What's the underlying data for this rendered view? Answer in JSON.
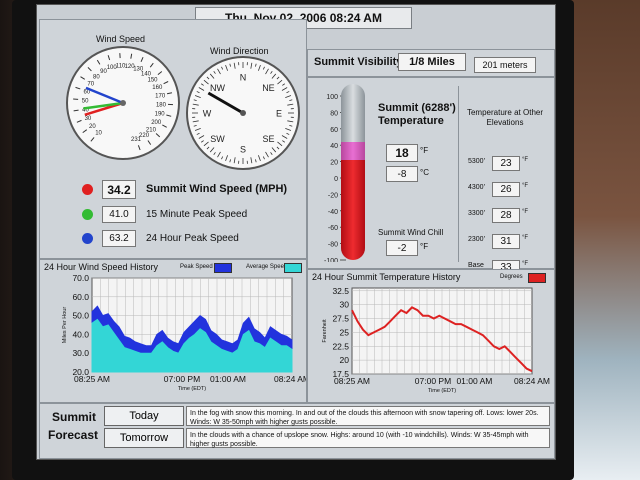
{
  "header": {
    "date_time": "Thu, Nov 02, 2006  08:24 AM"
  },
  "wind": {
    "speed_title": "Wind Speed",
    "direction_title": "Wind Direction",
    "speed_ticks": [
      "10",
      "20",
      "30",
      "40",
      "50",
      "60",
      "70",
      "80",
      "90",
      "100",
      "110",
      "120",
      "130",
      "140",
      "150",
      "160",
      "170",
      "180",
      "190",
      "200",
      "210",
      "220",
      "231"
    ],
    "compass": [
      "N",
      "NE",
      "E",
      "SE",
      "S",
      "SW",
      "W",
      "NW"
    ],
    "direction_deg": 300,
    "summit_speed_value": "34.2",
    "summit_speed_label": "Summit Wind Speed (MPH)",
    "peak15_value": "41.0",
    "peak15_label": "15 Minute Peak Speed",
    "peak24_value": "63.2",
    "peak24_label": "24 Hour Peak Speed",
    "colors": {
      "summit": "#e02020",
      "peak15": "#33bb33",
      "peak24": "#2244cc"
    }
  },
  "visibility": {
    "label": "Summit Visibility",
    "miles": "1/8 Miles",
    "meters": "201 meters"
  },
  "temperature": {
    "title": "Summit (6288') Temperature",
    "value_f": "18",
    "unit_f": "°F",
    "value_c": "-8",
    "unit_c": "°C",
    "scale": [
      "100",
      "80",
      "60",
      "40",
      "20",
      "0",
      "-20",
      "-40",
      "-60",
      "-80",
      "-100"
    ],
    "wind_chill_label": "Summit Wind Chill",
    "wind_chill_value": "-2",
    "wind_chill_unit": "°F"
  },
  "elevations": {
    "title": "Temperature at Other Elevations",
    "rows": [
      {
        "elev": "5300'",
        "temp": "23"
      },
      {
        "elev": "4300'",
        "temp": "26"
      },
      {
        "elev": "3300'",
        "temp": "28"
      },
      {
        "elev": "2300'",
        "temp": "31"
      },
      {
        "elev": "Base",
        "temp": "33"
      }
    ],
    "unit": "°F"
  },
  "wind_history": {
    "title": "24 Hour Wind Speed History",
    "legend_peak": "Peak Speed",
    "legend_avg": "Average Speed",
    "ylabel": "Miles Per Hour",
    "xlabel": "Time (EDT)",
    "yticks": [
      "70.0",
      "60.0",
      "50.0",
      "40.0",
      "30.0",
      "20.0"
    ],
    "xticks": [
      "08:25 AM",
      "07:00 PM",
      "01:00 AM",
      "08:24 AM"
    ]
  },
  "temp_history": {
    "title": "24 Hour Summit Temperature History",
    "legend": "Degrees",
    "ylabel": "Farenheit",
    "xlabel": "Time (EDT)",
    "yticks": [
      "32.5",
      "30",
      "27.5",
      "25",
      "22.5",
      "20",
      "17.5"
    ],
    "xticks": [
      "08:25 AM",
      "07:00 PM",
      "01:00 AM",
      "08:24 AM"
    ]
  },
  "forecast": {
    "label_1": "Summit",
    "label_2": "Forecast",
    "today_label": "Today",
    "tomorrow_label": "Tomorrow",
    "today_text": "In the fog with snow this morning. In and out of the clouds this afternoon with snow tapering off. Lows: lower 20s. Winds: W 35-50mph with higher gusts possible.",
    "tomorrow_text": "In the clouds with a chance of upslope snow. Highs: around 10 (with -10 windchills). Winds: W 35-45mph with higher gusts possible."
  },
  "chart_data": [
    {
      "type": "area",
      "title": "24 Hour Wind Speed History",
      "xlabel": "Time (EDT)",
      "ylabel": "Miles Per Hour",
      "ylim": [
        20,
        70
      ],
      "x_ticks": [
        "08:25 AM",
        "07:00 PM",
        "01:00 AM",
        "08:24 AM"
      ],
      "series": [
        {
          "name": "Peak Speed",
          "color": "#2233dd",
          "values": [
            52,
            55,
            50,
            51,
            47,
            44,
            39,
            38,
            36,
            35,
            34,
            34,
            40,
            42,
            38,
            36,
            35,
            41,
            44,
            47,
            50,
            48,
            42,
            40,
            37,
            36,
            35,
            37,
            46,
            49,
            43,
            41,
            38,
            44,
            42,
            40,
            39,
            37
          ]
        },
        {
          "name": "Average Speed",
          "color": "#33d6d6",
          "values": [
            46,
            48,
            44,
            45,
            41,
            37,
            33,
            32,
            31,
            30,
            30,
            30,
            34,
            36,
            33,
            31,
            30,
            35,
            38,
            40,
            43,
            41,
            36,
            34,
            32,
            31,
            30,
            32,
            40,
            42,
            36,
            35,
            33,
            38,
            36,
            34,
            34,
            32
          ]
        }
      ]
    },
    {
      "type": "line",
      "title": "24 Hour Summit Temperature History",
      "xlabel": "Time (EDT)",
      "ylabel": "Farenheit",
      "ylim": [
        17.5,
        33
      ],
      "x_ticks": [
        "08:25 AM",
        "07:00 PM",
        "01:00 AM",
        "08:24 AM"
      ],
      "series": [
        {
          "name": "Degrees",
          "color": "#dd2222",
          "values": [
            29,
            27,
            25.5,
            24.5,
            25,
            25.5,
            26,
            27,
            28,
            29,
            28.5,
            29.5,
            29,
            28,
            28,
            27.5,
            28,
            27.5,
            27,
            26.5,
            26.5,
            26,
            25.5,
            25,
            24.5,
            23.5,
            22.5,
            22,
            22.5,
            21.5,
            20.5,
            19.5,
            18.5,
            18
          ]
        }
      ]
    }
  ]
}
